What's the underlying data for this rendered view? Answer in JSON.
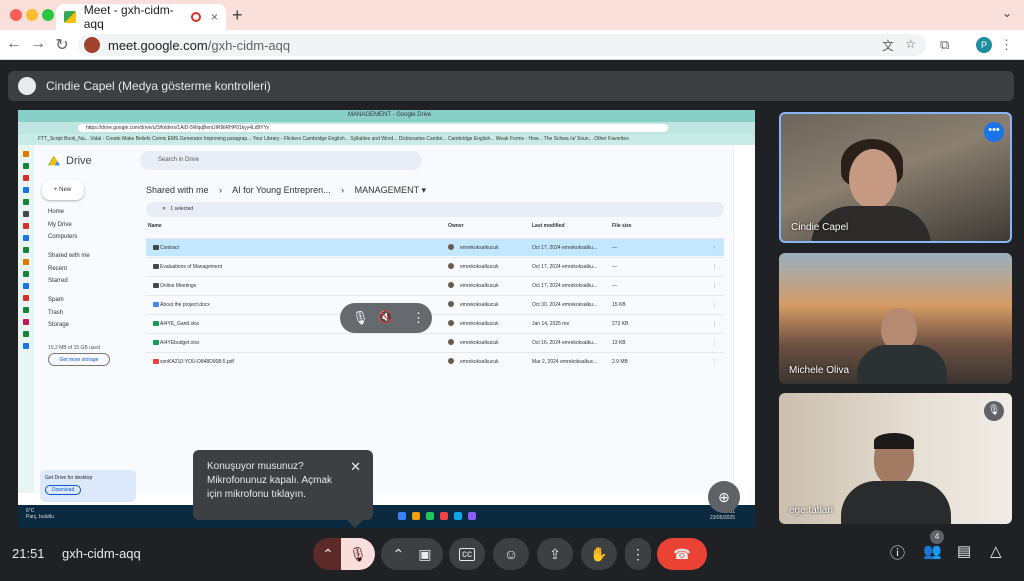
{
  "browser": {
    "tab_title": "Meet - gxh-cidm-aqq",
    "tab_close": "×",
    "new_tab": "+",
    "tab_menu": "⌄",
    "url_domain": "meet.google.com",
    "url_path": "/gxh-cidm-aqq",
    "profile_initial": "P"
  },
  "presenter_bar": {
    "label": "Cindie Capel (Medya gösterme kontrolleri)"
  },
  "shared_screen": {
    "tab_title": "MANAGEMENT - Google Drive",
    "url": "https://drive.google.com/drive/u/3/folders/1AiD-5WqqBenUIR9iiRHP01kyy4Ld9YYv",
    "bookmarks": "FTT_Script Book_Na...   Vidal - Create   Make Beliefs Comix   EMS Generator   Improving paragrap...   Your Library - Flickers   Cambridge English...   Syllables and Word...   Dictionaries Cambri...   Cambridge English...   Weak Forms - How...   The Schwa /ə/ Soun...   Other Favorites",
    "drive": {
      "logo": "Drive",
      "search_placeholder": "Search in Drive",
      "new_label": "New",
      "nav": [
        "Home",
        "My Drive",
        "Computers",
        "Shared with me",
        "Recent",
        "Starred",
        "Spam",
        "Trash",
        "Storage"
      ],
      "storage_text": "15.2 MB of 15 GB used",
      "get_more_storage": "Get more storage",
      "promo_title": "Get Drive for desktop",
      "promo_button": "Download",
      "breadcrumb": [
        "Shared with me",
        "AI for Young Entrepren...",
        "MANAGEMENT"
      ],
      "selection_text": "1 selected",
      "columns": [
        "Name",
        "Owner",
        "Last modified",
        "File size"
      ],
      "files": [
        {
          "name": "Contract",
          "owner": "emrekoksalkucuk",
          "modified": "Oct 17, 2024 emrekoksalku...",
          "size": "—",
          "kind": "folder",
          "color": "#444746"
        },
        {
          "name": "Evaluations of Management",
          "owner": "emrekoksalkucuk",
          "modified": "Oct 17, 2024 emrekoksalku...",
          "size": "—",
          "kind": "folder",
          "color": "#444746"
        },
        {
          "name": "Online Meetings",
          "owner": "emrekoksalkucuk",
          "modified": "Oct 17, 2024 emrekoksalku...",
          "size": "—",
          "kind": "folder",
          "color": "#444746"
        },
        {
          "name": "About the project.docx",
          "owner": "emrekoksalkucuk",
          "modified": "Oct 30, 2024 emrekoksalku...",
          "size": "15 KB",
          "kind": "docx",
          "color": "#4285f4"
        },
        {
          "name": "AI4YE_Gantt.xlsx",
          "owner": "emrekoksalkucuk",
          "modified": "Jan 14, 2025 me",
          "size": "273 KB",
          "kind": "xlsx",
          "color": "#0f9d58"
        },
        {
          "name": "AI4YEbudget.xlsx",
          "owner": "emrekoksalkucuk",
          "modified": "Oct 16, 2024 emrekoksalku...",
          "size": "13 KB",
          "kind": "xlsx",
          "color": "#0f9d58"
        },
        {
          "name": "sonKA210-YOU-D848D908-5.pdf",
          "owner": "emrekoksalkucuk",
          "modified": "Mar 2, 2024 emrekoksalkuc...",
          "size": "2.9 MB",
          "kind": "pdf",
          "color": "#ea4335"
        }
      ]
    },
    "taskbar": {
      "weather_temp": "6°C",
      "weather_desc": "Parç. bulutlu",
      "time": "19:51",
      "date": "23/05/2025"
    }
  },
  "participants": [
    {
      "name": "Cindie Capel",
      "more_icon": "•••"
    },
    {
      "name": "Michele Oliva"
    },
    {
      "name": "ege.tatlari",
      "muted_icon": "🎙"
    }
  ],
  "toast": {
    "line1": "Konuşuyor musunuz?",
    "line2": "Mikrofonunuz kapalı. Açmak için mikrofonu tıklayın.",
    "close": "✕"
  },
  "bottom_bar": {
    "time": "21:51",
    "meeting_code": "gxh-cidm-aqq",
    "people_count": "4"
  },
  "colors": {
    "meet_bg": "#202124",
    "control_dark": "#3c4043",
    "mic_off_red": "#f9dedc",
    "end_call_red": "#ea4335",
    "accent_blue": "#8ab4f8"
  }
}
